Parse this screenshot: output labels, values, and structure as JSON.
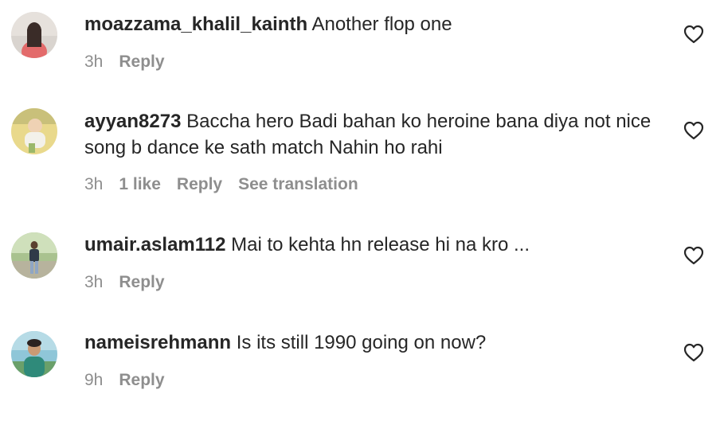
{
  "comments": [
    {
      "username": "moazzama_khalil_kainth",
      "text": "Another flop one",
      "time": "3h",
      "likes": "",
      "reply": "Reply",
      "translation": ""
    },
    {
      "username": "ayyan8273",
      "text": "Baccha hero Badi bahan ko heroine bana diya not nice song b dance ke sath match Nahin ho rahi",
      "time": "3h",
      "likes": "1 like",
      "reply": "Reply",
      "translation": "See translation"
    },
    {
      "username": "umair.aslam112",
      "text": "Mai to kehta hn release hi na kro ...",
      "time": "3h",
      "likes": "",
      "reply": "Reply",
      "translation": ""
    },
    {
      "username": "nameisrehmann",
      "text": "Is its still 1990 going on now?",
      "time": "9h",
      "likes": "",
      "reply": "Reply",
      "translation": ""
    }
  ],
  "icons": {
    "like": "heart-outline-icon",
    "avatar": "user-avatar"
  },
  "colors": {
    "text": "#262626",
    "meta": "#8e8e8e",
    "background": "#ffffff"
  }
}
